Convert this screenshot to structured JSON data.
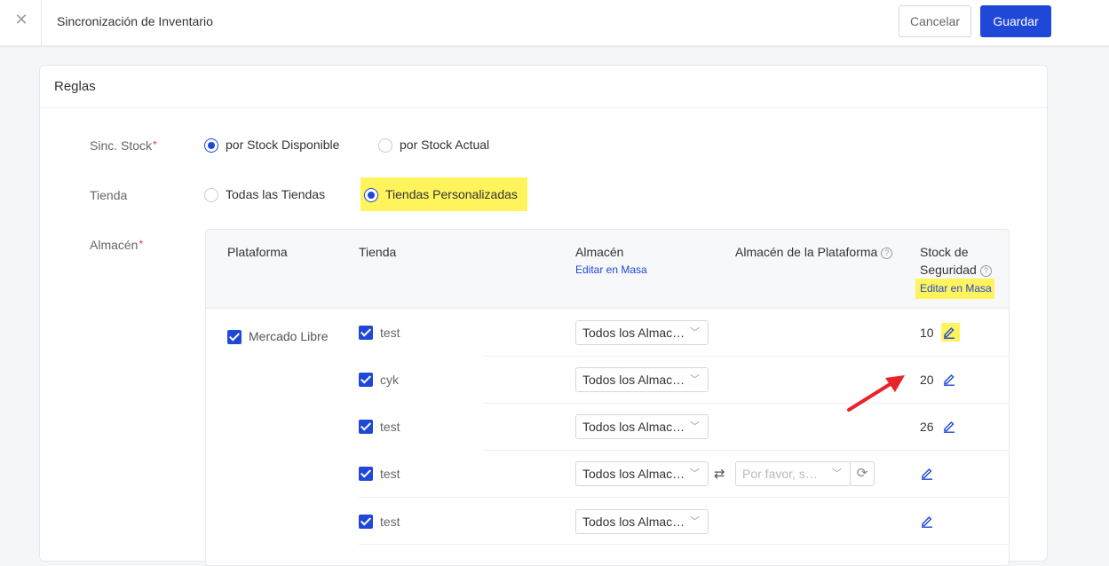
{
  "header": {
    "title": "Sincronización de Inventario",
    "cancel_label": "Cancelar",
    "save_label": "Guardar"
  },
  "section": {
    "title": "Reglas"
  },
  "sync_stock": {
    "label": "Sinc. Stock",
    "required_mark": "*",
    "options": [
      {
        "label": "por Stock Disponible",
        "selected": true
      },
      {
        "label": "por Stock Actual",
        "selected": false
      }
    ]
  },
  "store": {
    "label": "Tienda",
    "options": [
      {
        "label": "Todas las Tiendas",
        "selected": false
      },
      {
        "label": "Tiendas Personalizadas",
        "selected": true
      }
    ]
  },
  "warehouse": {
    "label": "Almacén",
    "required_mark": "*",
    "columns": {
      "platform": "Plataforma",
      "store": "Tienda",
      "warehouse": "Almacén",
      "warehouse_bulk_edit": "Editar en Masa",
      "platform_warehouse": "Almacén de la Plataforma",
      "safety_stock_line1": "Stock de",
      "safety_stock_line2": "Seguridad",
      "safety_stock_bulk_edit": "Editar en Masa"
    },
    "platform": "Mercado Libre",
    "rows": [
      {
        "store": "test",
        "warehouse": "Todos los Almac…",
        "safety_stock": "10"
      },
      {
        "store": "cyk",
        "warehouse": "Todos los Almac…",
        "safety_stock": "20"
      },
      {
        "store": "test",
        "warehouse": "Todos los Almac…",
        "safety_stock": "26"
      },
      {
        "store": "test",
        "warehouse": "Todos los Almac…",
        "platform_warehouse_placeholder": "Por favor, s…",
        "safety_stock": ""
      },
      {
        "store": "test",
        "warehouse": "Todos los Almac…",
        "safety_stock": ""
      }
    ]
  },
  "colors": {
    "primary": "#1f48d8",
    "highlight": "#fff45c",
    "annotation_arrow": "#e8232a"
  },
  "icons": [
    "close-icon",
    "help-icon",
    "checkbox-checked-icon",
    "chevron-down-icon",
    "swap-icon",
    "refresh-icon",
    "edit-pencil-icon",
    "annotation-arrow"
  ]
}
